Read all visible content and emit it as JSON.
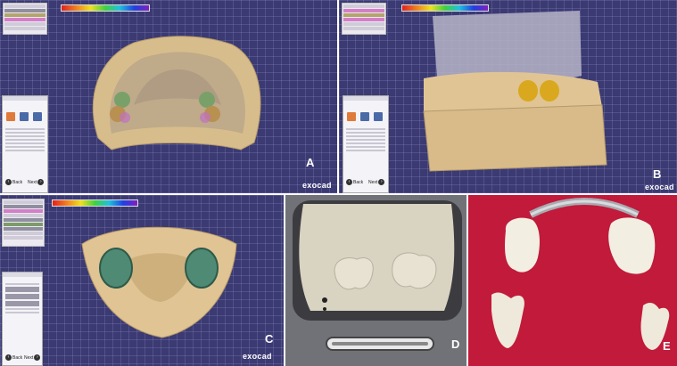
{
  "panels": [
    {
      "letter": "A",
      "brand": "exocad"
    },
    {
      "letter": "B",
      "brand": "exocad"
    },
    {
      "letter": "C",
      "brand": "exocad"
    },
    {
      "letter": "D"
    },
    {
      "letter": "E"
    }
  ],
  "wizard": {
    "back_label": "Back",
    "next_label": "Next"
  },
  "colors": {
    "grid_bg": "#3b3a72",
    "model_beige": "#e0c494",
    "crown_green": "#4f8a74",
    "crown_gold": "#d9a81e",
    "photo_bg_red": "#c11a3a"
  }
}
